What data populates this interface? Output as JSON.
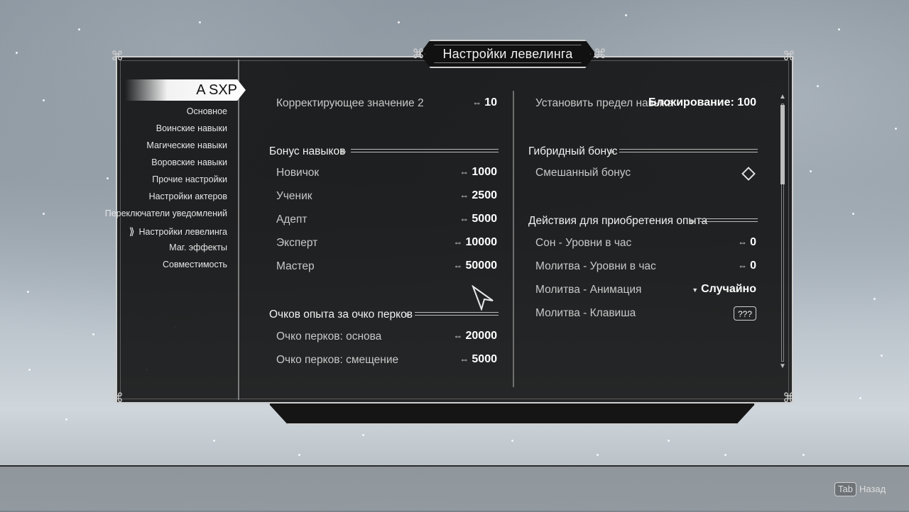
{
  "title": "Настройки левелинга",
  "sidebar": {
    "active": "A SXP",
    "items": [
      "Основное",
      "Воинские навыки",
      "Магические навыки",
      "Воровские навыки",
      "Прочие настройки",
      "Настройки актеров",
      "Переключатели уведомлений",
      "Настройки левелинга",
      "Маг. эффекты",
      "Совместимость"
    ]
  },
  "left": {
    "correction": {
      "label": "Корректирующее значение 2",
      "value": "10"
    },
    "skill_bonus": {
      "header": "Бонус навыков",
      "rows": [
        {
          "label": "Новичок",
          "value": "1000"
        },
        {
          "label": "Ученик",
          "value": "2500"
        },
        {
          "label": "Адепт",
          "value": "5000"
        },
        {
          "label": "Эксперт",
          "value": "10000"
        },
        {
          "label": "Мастер",
          "value": "50000"
        }
      ]
    },
    "perk_xp": {
      "header": "Очков опыта за очко перков",
      "rows": [
        {
          "label": "Очко перков: основа",
          "value": "20000"
        },
        {
          "label": "Очко перков: смещение",
          "value": "5000"
        }
      ]
    }
  },
  "right": {
    "limit": {
      "label": "Установить предел навыка",
      "value": "Блокирование:  100"
    },
    "hybrid": {
      "header": "Гибридный бонус",
      "row": {
        "label": "Смешанный бонус"
      }
    },
    "actions": {
      "header": "Действия для приобретения опыта",
      "rows": [
        {
          "label": "Сон - Уровни в час",
          "value": "0"
        },
        {
          "label": "Молитва - Уровни в час",
          "value": "0"
        },
        {
          "label": "Молитва - Анимация",
          "value": "Случайно"
        },
        {
          "label": "Молитва - Клавиша",
          "value": "???"
        }
      ]
    }
  },
  "footer": {
    "key": "Tab",
    "label": "Назад"
  }
}
